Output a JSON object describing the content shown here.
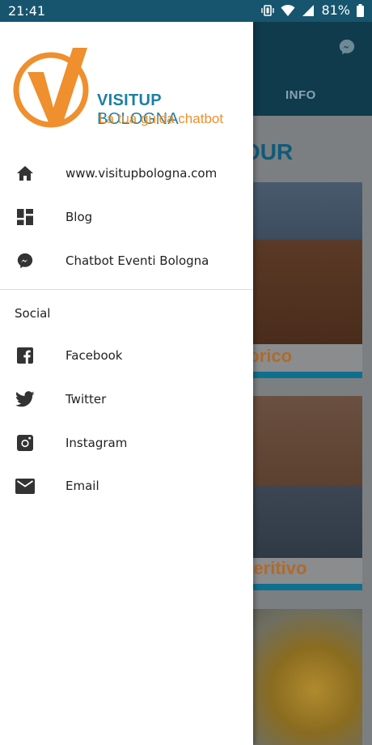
{
  "status_bar": {
    "time": "21:41",
    "battery": "81%",
    "icons": [
      "vibrate-icon",
      "wifi-icon",
      "signal-icon",
      "battery-icon"
    ]
  },
  "background_app": {
    "tab_info": "INFO",
    "section_title": "OUR",
    "cards": [
      {
        "label": "torico"
      },
      {
        "label": "peritivo"
      },
      {
        "label": ""
      }
    ]
  },
  "drawer": {
    "brand": {
      "name_bold": "VISITUP",
      "name_rest": " BOLOGNA",
      "tagline": "La tua guida chatbot"
    },
    "items": [
      {
        "label": "www.visitupbologna.com",
        "icon": "home-icon"
      },
      {
        "label": "Blog",
        "icon": "dashboard-icon"
      },
      {
        "label": "Chatbot Eventi Bologna",
        "icon": "messenger-icon"
      }
    ],
    "social_label": "Social",
    "social_items": [
      {
        "label": "Facebook",
        "icon": "facebook-icon"
      },
      {
        "label": "Twitter",
        "icon": "twitter-icon"
      },
      {
        "label": "Instagram",
        "icon": "instagram-icon"
      },
      {
        "label": "Email",
        "icon": "email-icon"
      }
    ]
  },
  "colors": {
    "status_bar": "#17556e",
    "brand_blue": "#1d7fa5",
    "brand_orange": "#ef8f2d",
    "icon_dark": "#333333"
  }
}
